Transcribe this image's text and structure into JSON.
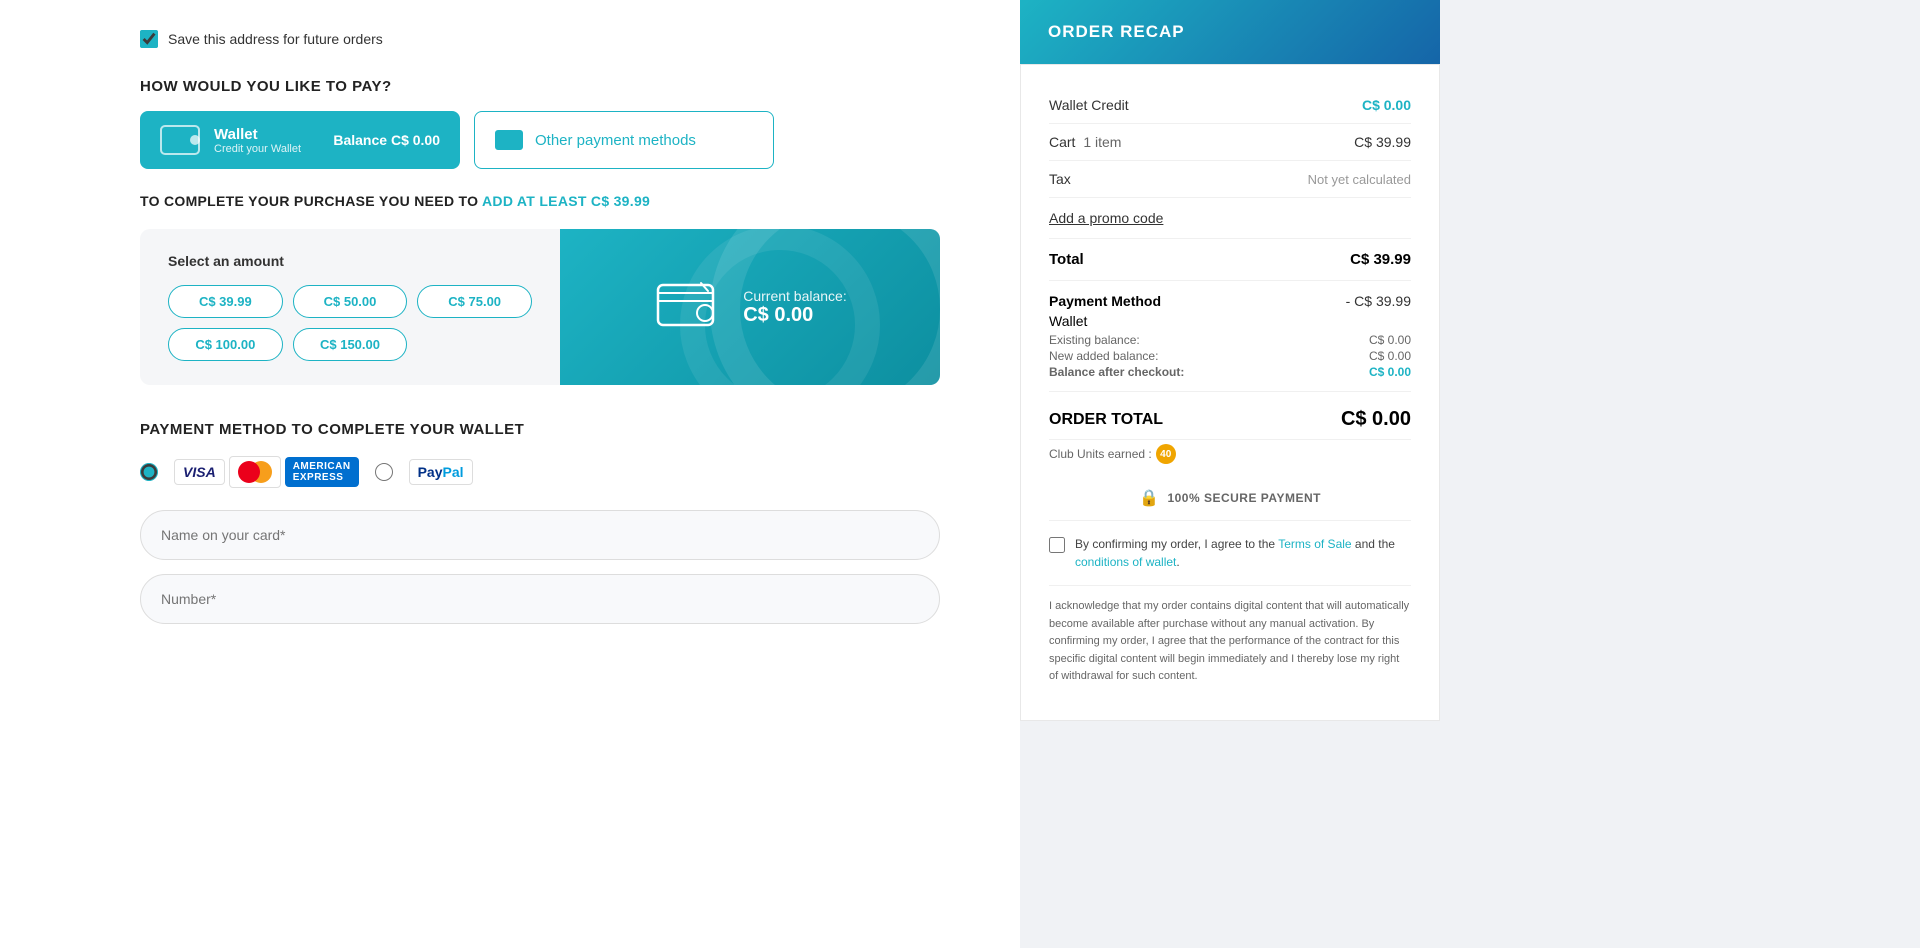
{
  "page": {
    "save_address_label": "Save this address for future orders",
    "how_to_pay_title": "HOW WOULD YOU LIKE TO PAY?",
    "wallet_name": "Wallet",
    "wallet_sub": "Credit your Wallet",
    "wallet_balance_prefix": "Balance",
    "wallet_balance": "C$ 0.00",
    "other_payment_label": "Other payment methods",
    "purchase_warning_prefix": "TO COMPLETE YOUR PURCHASE YOU NEED TO",
    "purchase_warning_amount": "ADD AT LEAST C$ 39.99",
    "select_amount_label": "Select an amount",
    "amount_options": [
      "C$ 39.99",
      "C$ 50.00",
      "C$ 75.00",
      "C$ 100.00",
      "C$ 150.00"
    ],
    "current_balance_label": "Current balance:",
    "current_balance_value": "C$ 0.00",
    "payment_method_title": "PAYMENT METHOD TO COMPLETE YOUR WALLET",
    "card_name_placeholder": "Name on your card*",
    "card_number_placeholder": "Number*"
  },
  "order_recap": {
    "title": "ORDER RECAP",
    "wallet_credit_label": "Wallet Credit",
    "wallet_credit_value": "C$ 0.00",
    "cart_label": "Cart",
    "cart_items": "1 item",
    "cart_value": "C$ 39.99",
    "tax_label": "Tax",
    "tax_value": "Not yet calculated",
    "promo_link": "Add a promo code",
    "total_label": "Total",
    "total_value": "C$ 39.99",
    "payment_method_label": "Payment Method",
    "payment_method_value": "- C$ 39.99",
    "wallet_label": "Wallet",
    "existing_balance_label": "Existing balance:",
    "existing_balance_value": "C$ 0.00",
    "new_added_label": "New added balance:",
    "new_added_value": "C$ 0.00",
    "balance_after_label": "Balance after checkout:",
    "balance_after_value": "C$ 0.00",
    "order_total_label": "ORDER TOTAL",
    "order_total_value": "C$ 0.00",
    "club_units_label": "Club Units earned :",
    "club_units_value": "40",
    "secure_payment": "100% SECURE PAYMENT",
    "terms_text_before": "By confirming my order, I agree to the",
    "terms_of_sale": "Terms of Sale",
    "terms_and": "and the",
    "conditions_wallet": "conditions of wallet",
    "disclaimer": "I acknowledge that my order contains digital content that will automatically become available after purchase without any manual activation. By confirming my order, I agree that the performance of the contract for this specific digital content will begin immediately and I thereby lose my right of withdrawal for such content."
  }
}
